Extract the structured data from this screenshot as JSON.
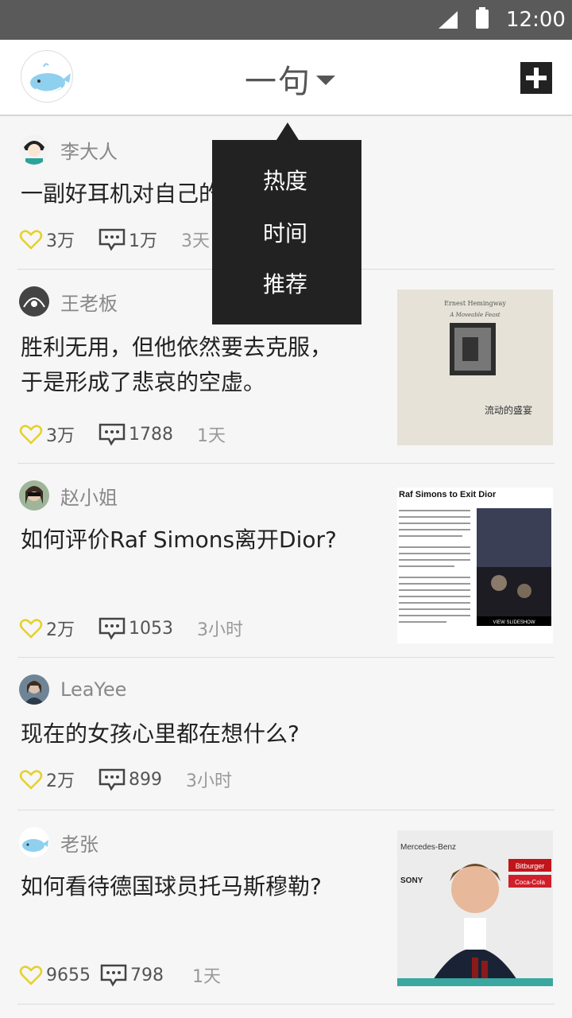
{
  "status_bar": {
    "time": "12:00"
  },
  "header": {
    "title": "一句"
  },
  "dropdown": {
    "options": [
      "热度",
      "时间",
      "推荐"
    ]
  },
  "posts": [
    {
      "author": "李大人",
      "question": "一副好耳机对自己的影响有多大?",
      "likes": "3万",
      "comments": "1万",
      "age": "3天"
    },
    {
      "author": "王老板",
      "question_line1": "胜利无用，但他依然要去克服，",
      "question_line2": "于是形成了悲哀的空虚。",
      "likes": "3万",
      "comments": "1788",
      "age": "1天",
      "thumb": {
        "author_line": "Ernest Hemingway",
        "subtitle": "A Moveable Feast",
        "cn_title": "流动的盛宴"
      }
    },
    {
      "author": "赵小姐",
      "question": "如何评价Raf Simons离开Dior?",
      "likes": "2万",
      "comments": "1053",
      "age": "3小时",
      "thumb": {
        "headline": "Raf Simons to Exit Dior",
        "badge": "VIEW SLIDESHOW"
      }
    },
    {
      "author": "LeaYee",
      "question": "现在的女孩心里都在想什么?",
      "likes": "2万",
      "comments": "899",
      "age": "3小时"
    },
    {
      "author": "老张",
      "question": "如何看待德国球员托马斯穆勒?",
      "likes": "9655",
      "comments": "798",
      "age": "1天",
      "thumb": {
        "sponsor1": "Mercedes-Benz",
        "sponsor2": "SONY",
        "sponsor3": "Coca-Cola",
        "sponsor4": "Bitburger"
      }
    }
  ],
  "colors": {
    "accent_heart": "#e6d02a",
    "header_bg": "#ffffff",
    "status_bg": "#5a5a5a",
    "dropdown_bg": "#222222"
  }
}
